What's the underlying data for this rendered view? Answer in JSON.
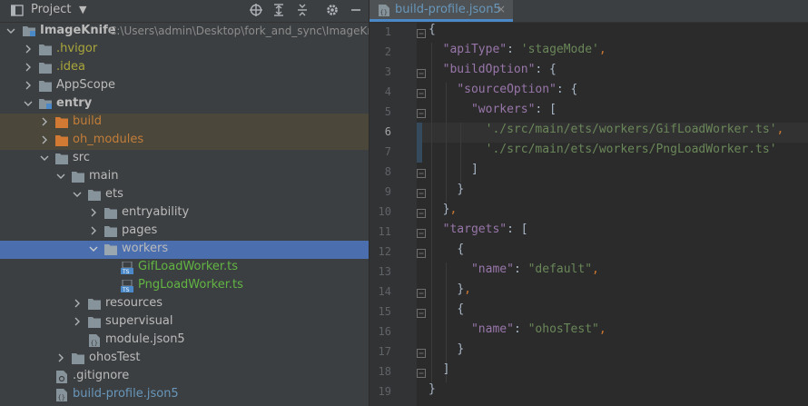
{
  "project_panel": {
    "title": "Project",
    "toolbar": [
      "locate-icon",
      "expand-all-icon",
      "collapse-all-icon",
      "settings-icon",
      "hide-icon"
    ]
  },
  "tree": [
    {
      "label": "ImageKnife",
      "path": "C:\\Users\\admin\\Desktop\\fork_and_sync\\ImageKn"
    },
    {
      "label": ".hvigor"
    },
    {
      "label": ".idea"
    },
    {
      "label": "AppScope"
    },
    {
      "label": "entry"
    },
    {
      "label": "build"
    },
    {
      "label": "oh_modules"
    },
    {
      "label": "src"
    },
    {
      "label": "main"
    },
    {
      "label": "ets"
    },
    {
      "label": "entryability"
    },
    {
      "label": "pages"
    },
    {
      "label": "workers"
    },
    {
      "label": "GifLoadWorker.ts"
    },
    {
      "label": "PngLoadWorker.ts"
    },
    {
      "label": "resources"
    },
    {
      "label": "supervisual"
    },
    {
      "label": "module.json5"
    },
    {
      "label": "ohosTest"
    },
    {
      "label": ".gitignore"
    },
    {
      "label": "build-profile.json5"
    }
  ],
  "editor": {
    "tab_label": "build-profile.json5",
    "tab_close": "×",
    "line_numbers": [
      "1",
      "2",
      "3",
      "4",
      "5",
      "6",
      "7",
      "8",
      "9",
      "10",
      "11",
      "12",
      "13",
      "14",
      "15",
      "16",
      "17",
      "18",
      "19"
    ],
    "code": {
      "l1_brace": "{",
      "l2_key": "\"apiType\"",
      "l2_value": "'stageMode'",
      "l3_key": "\"buildOption\"",
      "l4_key": "\"sourceOption\"",
      "l5_key": "\"workers\"",
      "l6_value": "'./src/main/ets/workers/GifLoadWorker.ts'",
      "l7_value": "'./src/main/ets/workers/PngLoadWorker.ts'",
      "l8_close": "]",
      "l9_close": "}",
      "l10_close": "}",
      "l11_key": "\"targets\"",
      "l12_open": "{",
      "l13_key": "\"name\"",
      "l13_value": "\"default\"",
      "l14_close": "}",
      "l15_open": "{",
      "l16_key": "\"name\"",
      "l16_value": "\"ohosTest\"",
      "l17_close": "}",
      "l18_close": "]",
      "l19_brace": "}"
    }
  }
}
